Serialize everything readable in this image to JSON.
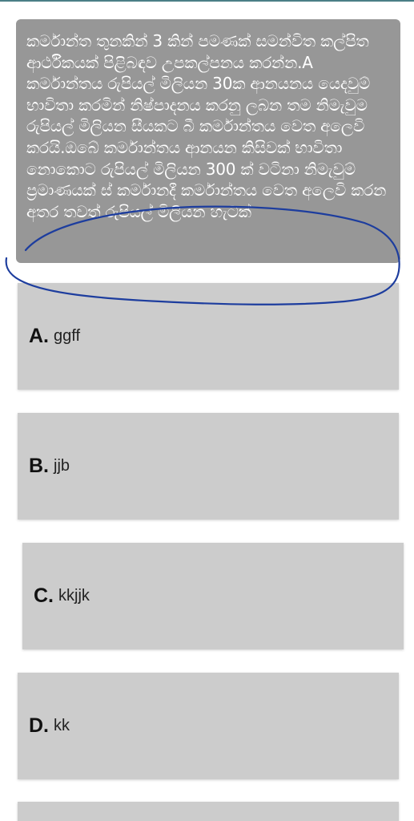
{
  "question": {
    "text": "කර්මාන්ත තුනකින් 3 කින් පමණක් සමන්විත කල්පිත ආර්ථිකයක් පිළිබඳව උපකල්පනය කරන්න.A කර්මාන්තය රුපියල් මිලියන 30ක ආනයනය යෙදවුම් භාවිතා කරමින් නිෂ්පාදනය කරනු ලබන තම නිමැවුම රුපියල් මිලියන සීයකට බී කර්මාන්තය වෙත අලෙවි කරයි.ඔබේ කර්මාන්තය ආනයන කිසිවක් භාවිතා නොකොට රුපියල් මිලියන 300 ක් වටිනා නිමැවුම් ප්‍රමාණයක් ස් කර්මානදී කර්මාන්තය වෙත අලෙවි කරන අතර තවත් රුපියල් මිලියන හැටක්"
  },
  "options": [
    {
      "letter": "A.",
      "text": "ggff"
    },
    {
      "letter": "B.",
      "text": "jjb"
    },
    {
      "letter": "C.",
      "text": "kkjjk"
    },
    {
      "letter": "D.",
      "text": "kk"
    }
  ],
  "colors": {
    "question_bg": "#979797",
    "option_bg": "#cccccc",
    "annotation_ink": "#1d3d9e"
  }
}
